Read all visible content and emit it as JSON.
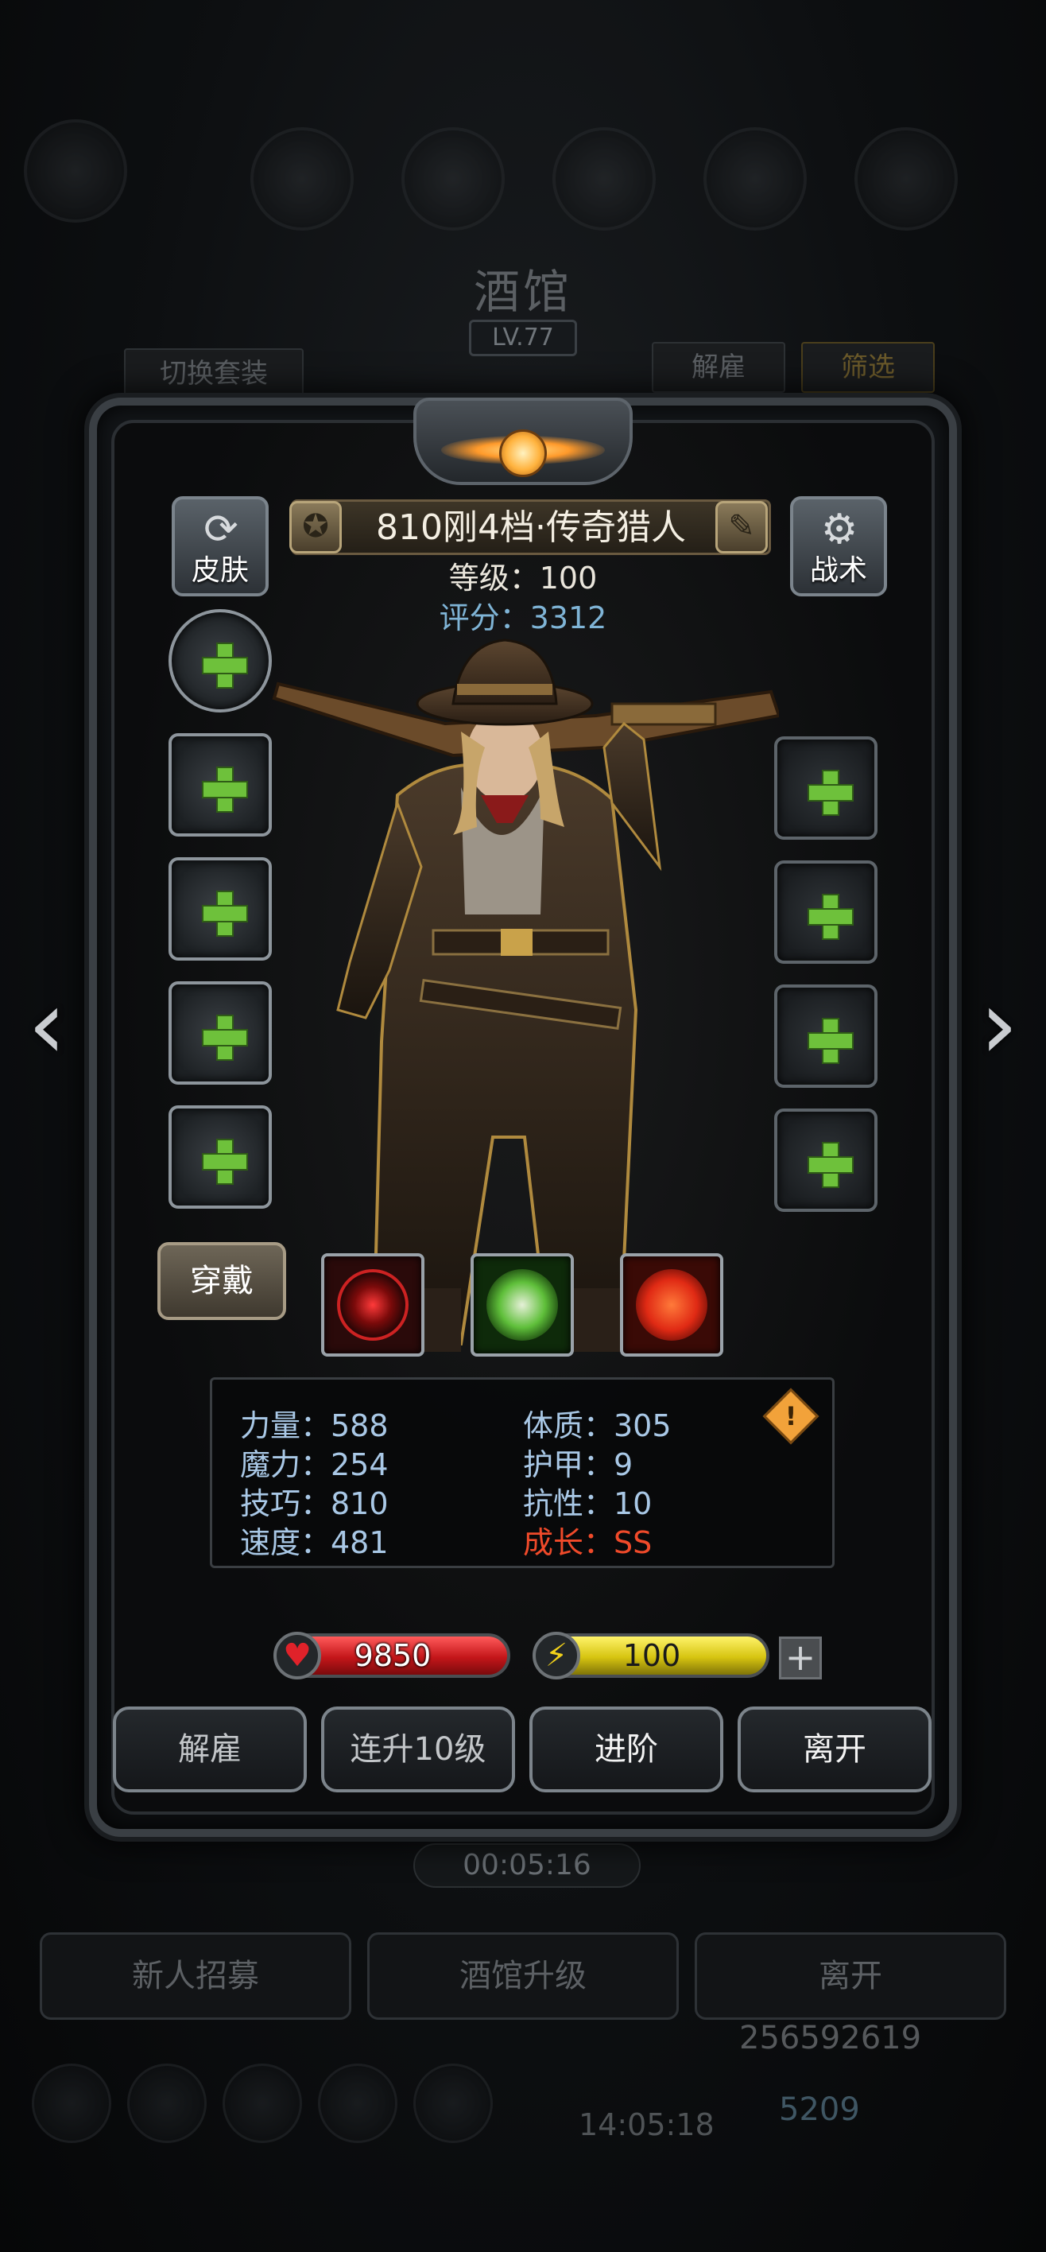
{
  "background": {
    "title": "酒馆",
    "level": "LV.77",
    "switch_outfit": "切换套装",
    "dismiss": "解雇",
    "filter": "筛选",
    "timer": "00:05:16",
    "bottom_buttons": [
      "新人招募",
      "酒馆升级",
      "离开"
    ],
    "gold": "256592619",
    "gems": "5209",
    "clock": "14:05:18"
  },
  "hero": {
    "name": "810刚4档·传奇猎人",
    "level_label": "等级：100",
    "score_label": "评分：3312",
    "skin_label": "皮肤",
    "tactics_label": "战术",
    "wear_label": "穿戴"
  },
  "stats": {
    "strength": "力量：588",
    "magic": "魔力：254",
    "skill": "技巧：810",
    "speed": "速度：481",
    "constitution": "体质：305",
    "armor": "护甲：9",
    "resistance": "抗性：10",
    "growth": "成长：SS"
  },
  "bars": {
    "hp": "9850",
    "energy": "100"
  },
  "actions": {
    "dismiss": "解雇",
    "upgrade10": "连升10级",
    "advance": "进阶",
    "leave": "离开"
  },
  "colors": {
    "score": "#7fb4d6",
    "stat": "#a9c8e6",
    "growth": "#f04a2a",
    "hp": "#c4161a",
    "energy": "#d6c410",
    "plus_green": "#6ec13b"
  }
}
